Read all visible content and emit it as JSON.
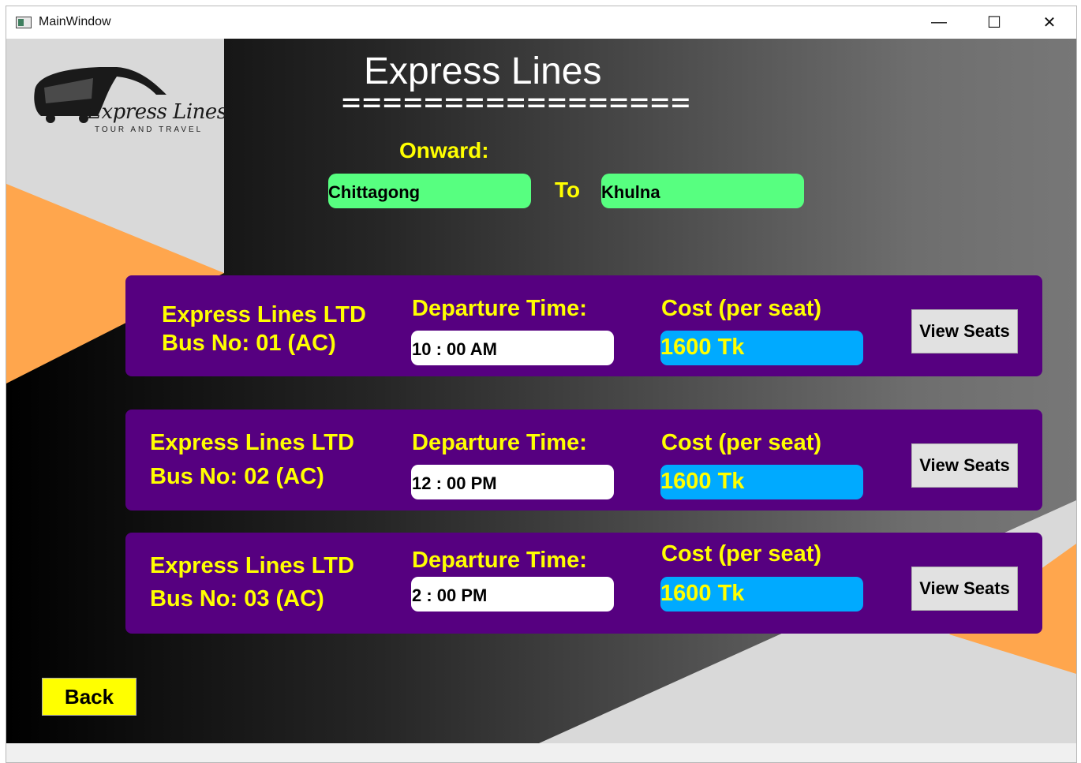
{
  "window": {
    "title": "MainWindow",
    "minimize_label": "—",
    "maximize_label": "☐",
    "close_label": "✕"
  },
  "logo": {
    "name": "Express Lines",
    "tagline": "TOUR AND TRAVEL"
  },
  "header": {
    "title": "Express Lines",
    "underline": "================="
  },
  "route": {
    "onward_label": "Onward:",
    "from": "Chittagong",
    "to_label": "To",
    "to": "Khulna"
  },
  "buses": [
    {
      "company": "Express Lines LTD",
      "bus_no": "Bus No: 01 (AC)",
      "departure_label": "Departure Time:",
      "departure_time": "10 : 00 AM",
      "cost_label": "Cost (per seat)",
      "cost": "1600 Tk",
      "view_label": "View Seats"
    },
    {
      "company": "Express Lines LTD",
      "bus_no": "Bus No: 02 (AC)",
      "departure_label": "Departure Time:",
      "departure_time": "12 : 00 PM",
      "cost_label": "Cost (per seat)",
      "cost": "1600 Tk",
      "view_label": "View Seats"
    },
    {
      "company": "Express Lines LTD",
      "bus_no": "Bus No: 03 (AC)",
      "departure_label": "Departure Time:",
      "departure_time": "2 : 00 PM",
      "cost_label": "Cost (per seat)",
      "cost": "1600 Tk",
      "view_label": "View Seats"
    }
  ],
  "back_label": "Back",
  "colors": {
    "card": "#560080",
    "accent_text": "#ffff00",
    "route_field": "#57ff80",
    "cost_field": "#00aaff",
    "orange": "#ffa64d"
  }
}
